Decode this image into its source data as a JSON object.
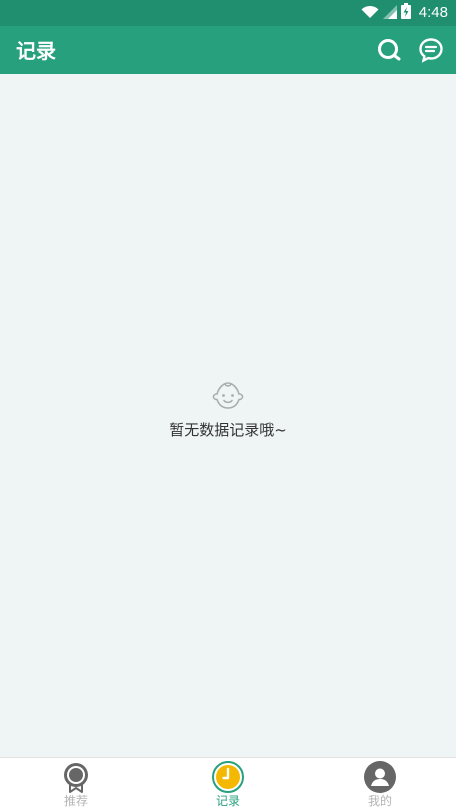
{
  "status_bar": {
    "time": "4:48",
    "icons": [
      "wifi-icon",
      "signal-icon",
      "battery-charging-icon"
    ]
  },
  "app_bar": {
    "title": "记录",
    "actions": [
      {
        "name": "search",
        "icon": "search-icon"
      },
      {
        "name": "messages",
        "icon": "message-icon"
      }
    ]
  },
  "empty_state": {
    "icon": "baby-face-icon",
    "text": "暂无数据记录哦~"
  },
  "bottom_nav": {
    "items": [
      {
        "label": "推荐",
        "icon": "medal-icon",
        "active": false
      },
      {
        "label": "记录",
        "icon": "clock-icon",
        "active": true
      },
      {
        "label": "我的",
        "icon": "user-icon",
        "active": false
      }
    ]
  },
  "colors": {
    "primary": "#27a07e",
    "status_bar": "#1f8f6f",
    "background": "#eef5f4",
    "active_accent": "#f5b800",
    "inactive": "#b5b5b5"
  }
}
